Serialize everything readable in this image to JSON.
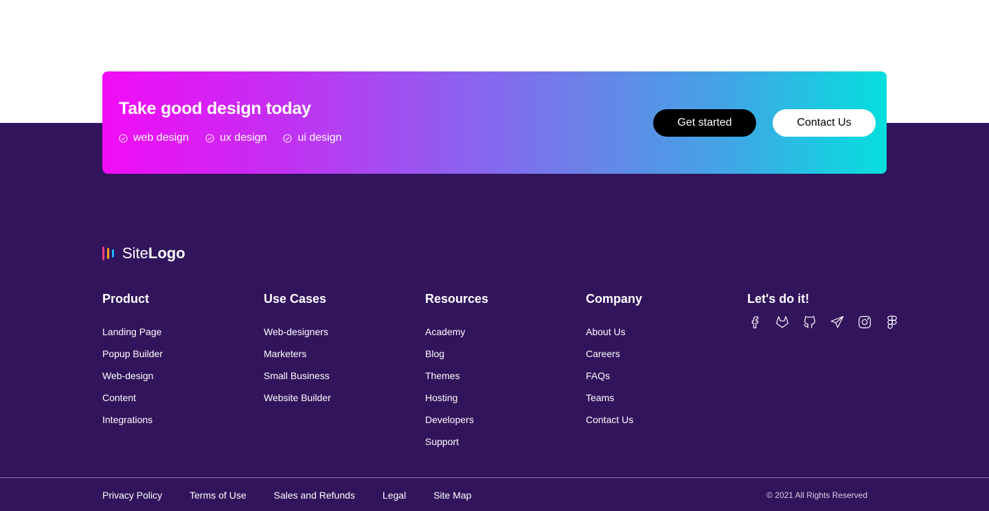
{
  "cta": {
    "title": "Take good design today",
    "tags": [
      "web design",
      "ux design",
      "ui design"
    ],
    "primary_button": "Get started",
    "secondary_button": "Contact Us"
  },
  "logo": {
    "prefix": "Site",
    "suffix": "Logo",
    "bar_colors": [
      "#ff3d7f",
      "#ffa51f",
      "#19b4f5"
    ]
  },
  "columns": [
    {
      "title": "Product",
      "links": [
        "Landing Page",
        "Popup Builder",
        "Web-design",
        "Content",
        "Integrations"
      ]
    },
    {
      "title": "Use Cases",
      "links": [
        "Web-designers",
        "Marketers",
        "Small Business",
        "Website Builder"
      ]
    },
    {
      "title": "Resources",
      "links": [
        "Academy",
        "Blog",
        "Themes",
        "Hosting",
        "Developers",
        "Support"
      ]
    },
    {
      "title": "Company",
      "links": [
        "About Us",
        "Careers",
        "FAQs",
        "Teams",
        "Contact Us"
      ]
    }
  ],
  "social": {
    "title": "Let's do it!",
    "icons": [
      "facebook-icon",
      "gitlab-icon",
      "github-icon",
      "telegram-icon",
      "instagram-icon",
      "figma-icon"
    ]
  },
  "bottom": {
    "links": [
      "Privacy Policy",
      "Terms of Use",
      "Sales and Refunds",
      "Legal",
      "Site Map"
    ],
    "copyright": "© 2021 All Rights Reserved"
  },
  "colors": {
    "footer_bg": "#32145c",
    "gradient_start": "#f20cf6",
    "gradient_end": "#06dfdd"
  }
}
